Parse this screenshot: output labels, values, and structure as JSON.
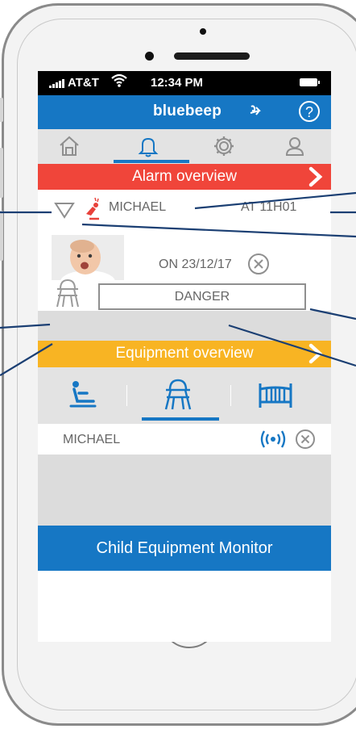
{
  "status_bar": {
    "carrier": "AT&T",
    "time": "12:34 PM"
  },
  "app": {
    "logo": "bluebeep",
    "help_label": "?"
  },
  "tabs": [
    {
      "icon": "home-icon"
    },
    {
      "icon": "bell-icon",
      "active": true
    },
    {
      "icon": "gear-icon"
    },
    {
      "icon": "user-icon"
    }
  ],
  "alarm_overview": {
    "title": "Alarm overview",
    "child_name": "MICHAEL",
    "time": "AT 11H01",
    "date": "ON 23/12/17",
    "status": "DANGER"
  },
  "equipment_overview": {
    "title": "Equipment overview",
    "tabs": [
      {
        "icon": "car-seat-icon"
      },
      {
        "icon": "high-chair-icon",
        "active": true
      },
      {
        "icon": "crib-icon"
      }
    ],
    "device": {
      "name": "MICHAEL"
    }
  },
  "footer": {
    "label": "Child Equipment Monitor"
  },
  "colors": {
    "primary_blue": "#1677c4",
    "alarm_red": "#f0453a",
    "equipment_yellow": "#f8b423",
    "panel_gray": "#dcdcdc"
  }
}
